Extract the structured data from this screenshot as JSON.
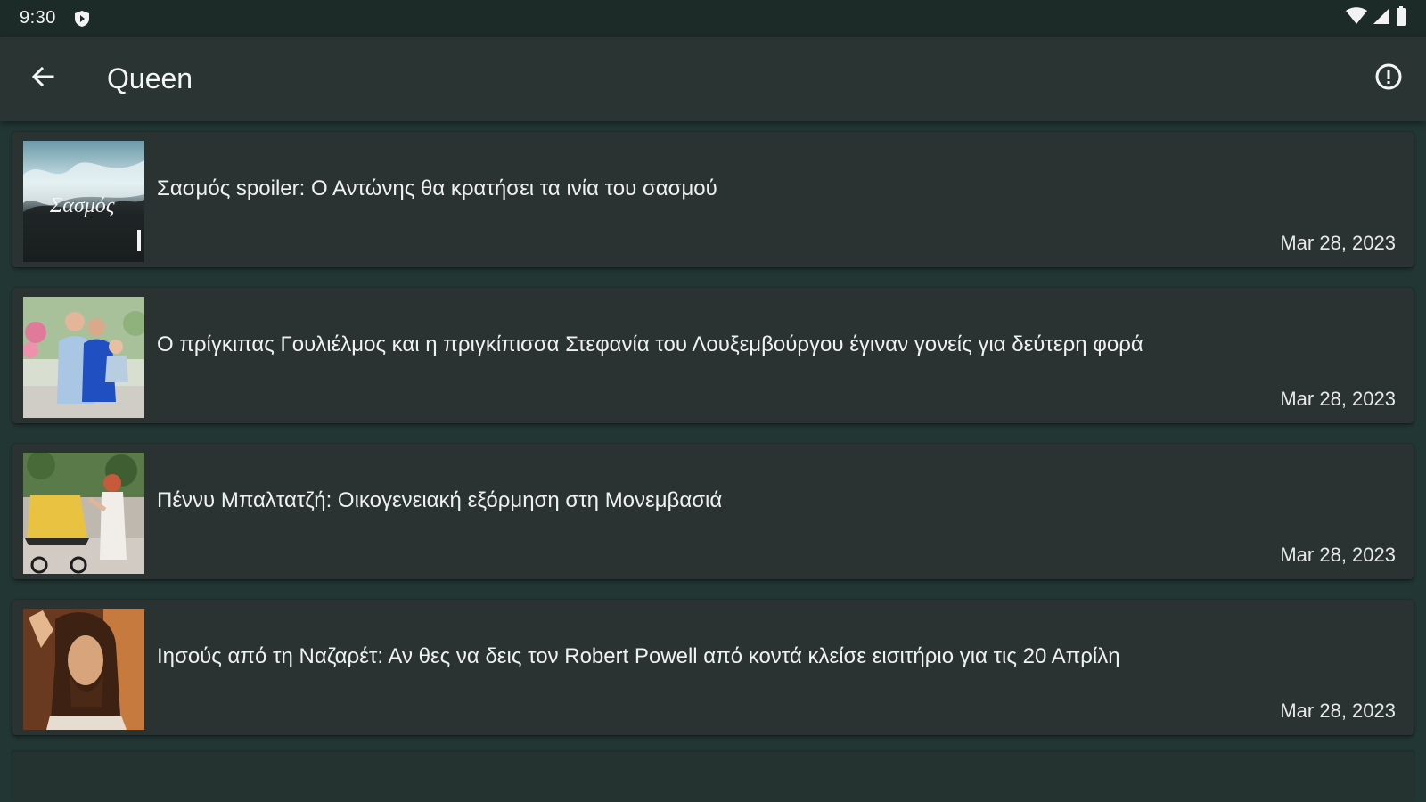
{
  "status_bar": {
    "time": "9:30",
    "notification_icon": "shield-play-icon",
    "right_icons": [
      "wifi-icon",
      "signal-icon",
      "battery-icon"
    ]
  },
  "app_bar": {
    "back_icon": "arrow-back-icon",
    "title": "Queen",
    "info_icon": "info-circle-icon"
  },
  "articles": [
    {
      "title": "Σασμός spoiler: Ο Αντώνης θα κρατήσει τα ινία του σασμού",
      "date": "Mar 28, 2023",
      "thumbnail": "sasmos-show-thumbnail",
      "thumbnail_text": "Σασμός"
    },
    {
      "title": "Ο πρίγκιπας Γουλιέλμος και η πριγκίπισσα Στεφανία του Λουξεμβούργου έγιναν γονείς για δεύτερη φορά",
      "date": "Mar 28, 2023",
      "thumbnail": "royal-family-thumbnail"
    },
    {
      "title": "Πέννυ Μπαλτατζή: Οικογενειακή εξόρμηση στη Μονεμβασιά",
      "date": "Mar 28, 2023",
      "thumbnail": "stroller-family-thumbnail"
    },
    {
      "title": "Ιησούς από τη Ναζαρέτ: Αν θες να δεις τον Robert Powell από κοντά κλείσε εισιτήριο για τις 20 Απρίλη",
      "date": "Mar 28, 2023",
      "thumbnail": "robert-powell-thumbnail"
    }
  ],
  "colors": {
    "background": "#223633",
    "status_bar": "#1c2a28",
    "app_bar": "#2a3433",
    "card": "#2b3332",
    "text": "#eef1f0"
  }
}
